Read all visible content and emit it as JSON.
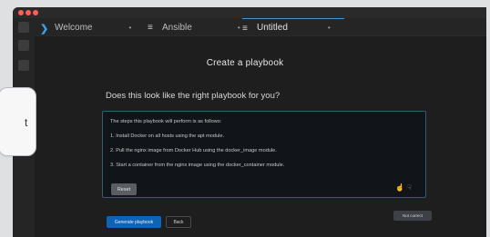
{
  "tabs": [
    {
      "icon": "vscode-icon",
      "label": "Welcome",
      "close": "•"
    },
    {
      "icon": "menu-icon",
      "label": "Ansible",
      "close": "•"
    },
    {
      "icon": "menu-icon",
      "label": "Untitled",
      "close": "•"
    }
  ],
  "header": {
    "title": "Create a playbook",
    "question": "Does this look like the right playbook for you?"
  },
  "panel": {
    "lines": [
      "The steps this playbook will perform is as follows:",
      "1.  Install Docker on all hosts using the apt module.",
      "2.  Pull the nginx image from Docker Hub using the docker_image module.",
      "3.  Start a container from the nginx image using the docker_container module."
    ],
    "reset_label": "Reset",
    "thumbs_up_icon": "thumbs-up-icon",
    "thumbs_down_icon": "thumbs-down-icon"
  },
  "tooltip": {
    "text": "Not correct"
  },
  "actions": {
    "generate_label": "Generate playbook",
    "back_label": "Back"
  },
  "side_card": {
    "text": "t"
  },
  "colors": {
    "accent": "#0e63b6",
    "panel_border": "#2f5f73",
    "tab_active_border": "#4e94ce"
  }
}
